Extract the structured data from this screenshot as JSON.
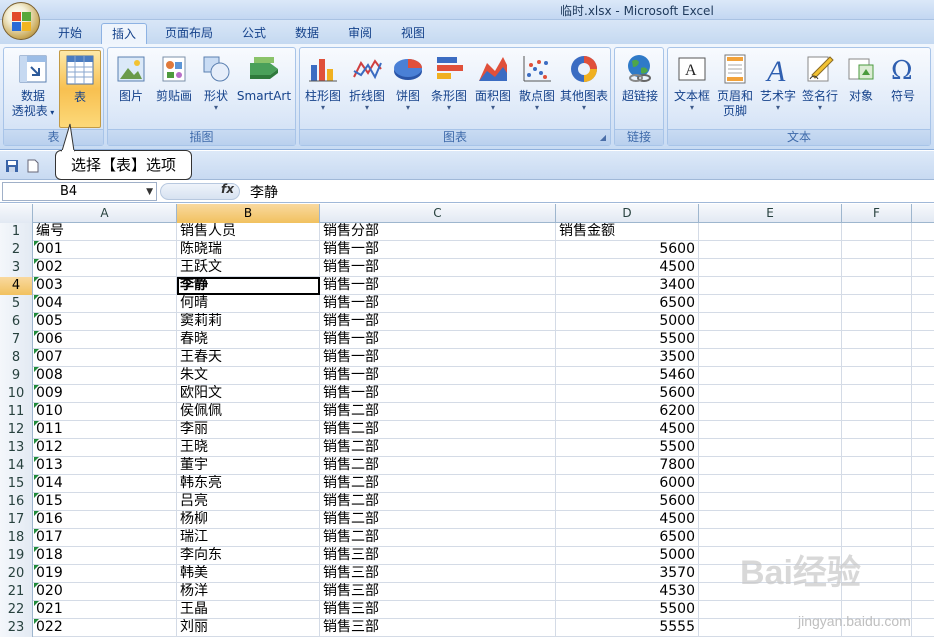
{
  "window": {
    "title": "临时.xlsx - Microsoft Excel"
  },
  "tabs": [
    {
      "label": "开始"
    },
    {
      "label": "插入"
    },
    {
      "label": "页面布局"
    },
    {
      "label": "公式"
    },
    {
      "label": "数据"
    },
    {
      "label": "审阅"
    },
    {
      "label": "视图"
    }
  ],
  "active_tab": "插入",
  "ribbon": {
    "groups": {
      "tables": "表",
      "illustrations": "插图",
      "charts": "图表",
      "links": "链接",
      "text": "文本"
    },
    "buttons": {
      "pivot_line1": "数据",
      "pivot_line2": "透视表",
      "table": "表",
      "picture": "图片",
      "clipart": "剪贴画",
      "shapes": "形状",
      "smartart": "SmartArt",
      "column": "柱形图",
      "line": "折线图",
      "pie": "饼图",
      "bar": "条形图",
      "area": "面积图",
      "scatter": "散点图",
      "other": "其他图表",
      "hyperlink": "超链接",
      "textbox": "文本框",
      "header_line1": "页眉和",
      "header_line2": "页脚",
      "wordart": "艺术字",
      "signature": "签名行",
      "object": "对象",
      "symbol": "符号"
    }
  },
  "callout": "选择【表】选项",
  "formula_bar": {
    "name_box": "B4",
    "fx": "fx",
    "content": "李静"
  },
  "columns": [
    "A",
    "B",
    "C",
    "D",
    "E",
    "F"
  ],
  "rows": [
    {
      "n": "1",
      "a": "编号",
      "b": "销售人员",
      "c": "销售分部",
      "d": "销售金额"
    },
    {
      "n": "2",
      "a": "001",
      "b": "陈晓瑞",
      "c": "销售一部",
      "d": "5600"
    },
    {
      "n": "3",
      "a": "002",
      "b": "王跃文",
      "c": "销售一部",
      "d": "4500"
    },
    {
      "n": "4",
      "a": "003",
      "b": "李静",
      "c": "销售一部",
      "d": "3400"
    },
    {
      "n": "5",
      "a": "004",
      "b": "何晴",
      "c": "销售一部",
      "d": "6500"
    },
    {
      "n": "6",
      "a": "005",
      "b": "窦莉莉",
      "c": "销售一部",
      "d": "5000"
    },
    {
      "n": "7",
      "a": "006",
      "b": "春晓",
      "c": "销售一部",
      "d": "5500"
    },
    {
      "n": "8",
      "a": "007",
      "b": "王春天",
      "c": "销售一部",
      "d": "3500"
    },
    {
      "n": "9",
      "a": "008",
      "b": "朱文",
      "c": "销售一部",
      "d": "5460"
    },
    {
      "n": "10",
      "a": "009",
      "b": "欧阳文",
      "c": "销售一部",
      "d": "5600"
    },
    {
      "n": "11",
      "a": "010",
      "b": "侯佩佩",
      "c": "销售二部",
      "d": "6200"
    },
    {
      "n": "12",
      "a": "011",
      "b": "李丽",
      "c": "销售二部",
      "d": "4500"
    },
    {
      "n": "13",
      "a": "012",
      "b": "王晓",
      "c": "销售二部",
      "d": "5500"
    },
    {
      "n": "14",
      "a": "013",
      "b": "董宇",
      "c": "销售二部",
      "d": "7800"
    },
    {
      "n": "15",
      "a": "014",
      "b": "韩东亮",
      "c": "销售二部",
      "d": "6000"
    },
    {
      "n": "16",
      "a": "015",
      "b": "吕亮",
      "c": "销售二部",
      "d": "5600"
    },
    {
      "n": "17",
      "a": "016",
      "b": "杨柳",
      "c": "销售二部",
      "d": "4500"
    },
    {
      "n": "18",
      "a": "017",
      "b": "瑞江",
      "c": "销售二部",
      "d": "6500"
    },
    {
      "n": "19",
      "a": "018",
      "b": "李向东",
      "c": "销售三部",
      "d": "5000"
    },
    {
      "n": "20",
      "a": "019",
      "b": "韩美",
      "c": "销售三部",
      "d": "3570"
    },
    {
      "n": "21",
      "a": "020",
      "b": "杨洋",
      "c": "销售三部",
      "d": "4530"
    },
    {
      "n": "22",
      "a": "021",
      "b": "王晶",
      "c": "销售三部",
      "d": "5500"
    },
    {
      "n": "23",
      "a": "022",
      "b": "刘丽",
      "c": "销售三部",
      "d": "5555"
    }
  ],
  "selected_cell": {
    "row": "4",
    "col": "B"
  },
  "watermark": {
    "text": "Bai经验",
    "sub": "jingyan.baidu.com"
  }
}
